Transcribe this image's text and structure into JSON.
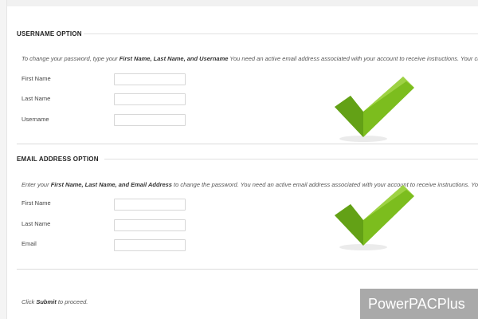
{
  "username_option": {
    "title": "USERNAME OPTION",
    "instructions_prefix": "To change your password, type your ",
    "instructions_bold": "First Name, Last Name, and Username",
    "instructions_suffix": " You need an active email address associated with your account to receive instructions. Your cur",
    "fields": [
      {
        "label": "First Name",
        "value": ""
      },
      {
        "label": "Last Name",
        "value": ""
      },
      {
        "label": "Username",
        "value": ""
      }
    ]
  },
  "email_option": {
    "title": "EMAIL ADDRESS OPTION",
    "instructions_prefix": "Enter your ",
    "instructions_bold": "First Name, Last Name, and Email Address",
    "instructions_suffix": " to change the password. You need an active email address associated with your account to receive instructions. Your",
    "fields": [
      {
        "label": "First Name",
        "value": ""
      },
      {
        "label": "Last Name",
        "value": ""
      },
      {
        "label": "Email",
        "value": ""
      }
    ]
  },
  "footer": {
    "proceed_prefix": "Click ",
    "proceed_bold": "Submit",
    "proceed_suffix": " to proceed."
  },
  "icons": {
    "checkmark_primary": "#7cbd1e",
    "checkmark_dark": "#4f8a10"
  },
  "watermark": "PowerPACPlus"
}
